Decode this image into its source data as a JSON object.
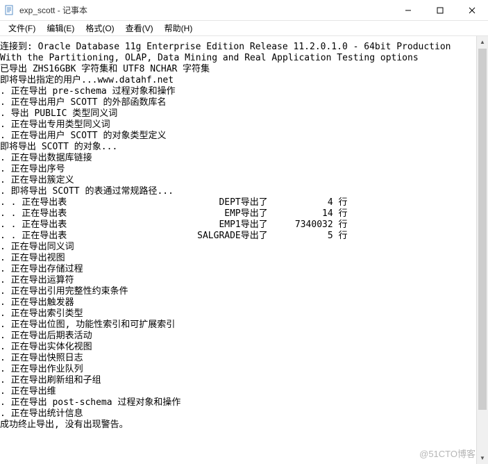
{
  "window": {
    "title": "exp_scott - 记事本",
    "icon_name": "notepad-icon"
  },
  "menubar": {
    "items": [
      "文件(F)",
      "编辑(E)",
      "格式(O)",
      "查看(V)",
      "帮助(H)"
    ]
  },
  "content": {
    "lines": [
      "",
      "连接到: Oracle Database 11g Enterprise Edition Release 11.2.0.1.0 - 64bit Production",
      "With the Partitioning, OLAP, Data Mining and Real Application Testing options",
      "已导出 ZHS16GBK 字符集和 UTF8 NCHAR 字符集",
      "",
      "即将导出指定的用户...www.datahf.net",
      ". 正在导出 pre-schema 过程对象和操作",
      ". 正在导出用户 SCOTT 的外部函数库名",
      ". 导出 PUBLIC 类型同义词",
      ". 正在导出专用类型同义词",
      ". 正在导出用户 SCOTT 的对象类型定义",
      "即将导出 SCOTT 的对象...",
      ". 正在导出数据库链接",
      ". 正在导出序号",
      ". 正在导出簇定义",
      ". 即将导出 SCOTT 的表通过常规路径...",
      ". . 正在导出表                            DEPT导出了           4 行",
      ". . 正在导出表                             EMP导出了          14 行",
      ". . 正在导出表                            EMP1导出了     7340032 行",
      ". . 正在导出表                        SALGRADE导出了           5 行",
      ". 正在导出同义词",
      ". 正在导出视图",
      ". 正在导出存储过程",
      ". 正在导出运算符",
      ". 正在导出引用完整性约束条件",
      ". 正在导出触发器",
      ". 正在导出索引类型",
      ". 正在导出位图, 功能性索引和可扩展索引",
      ". 正在导出后期表活动",
      ". 正在导出实体化视图",
      ". 正在导出快照日志",
      ". 正在导出作业队列",
      ". 正在导出刷新组和子组",
      ". 正在导出维",
      ". 正在导出 post-schema 过程对象和操作",
      ". 正在导出统计信息",
      "成功终止导出, 没有出现警告。"
    ]
  },
  "export_rows": [
    {
      "table": "DEPT",
      "rows": 4
    },
    {
      "table": "EMP",
      "rows": 14
    },
    {
      "table": "EMP1",
      "rows": 7340032
    },
    {
      "table": "SALGRADE",
      "rows": 5
    }
  ],
  "watermark": "@51CTO博客"
}
